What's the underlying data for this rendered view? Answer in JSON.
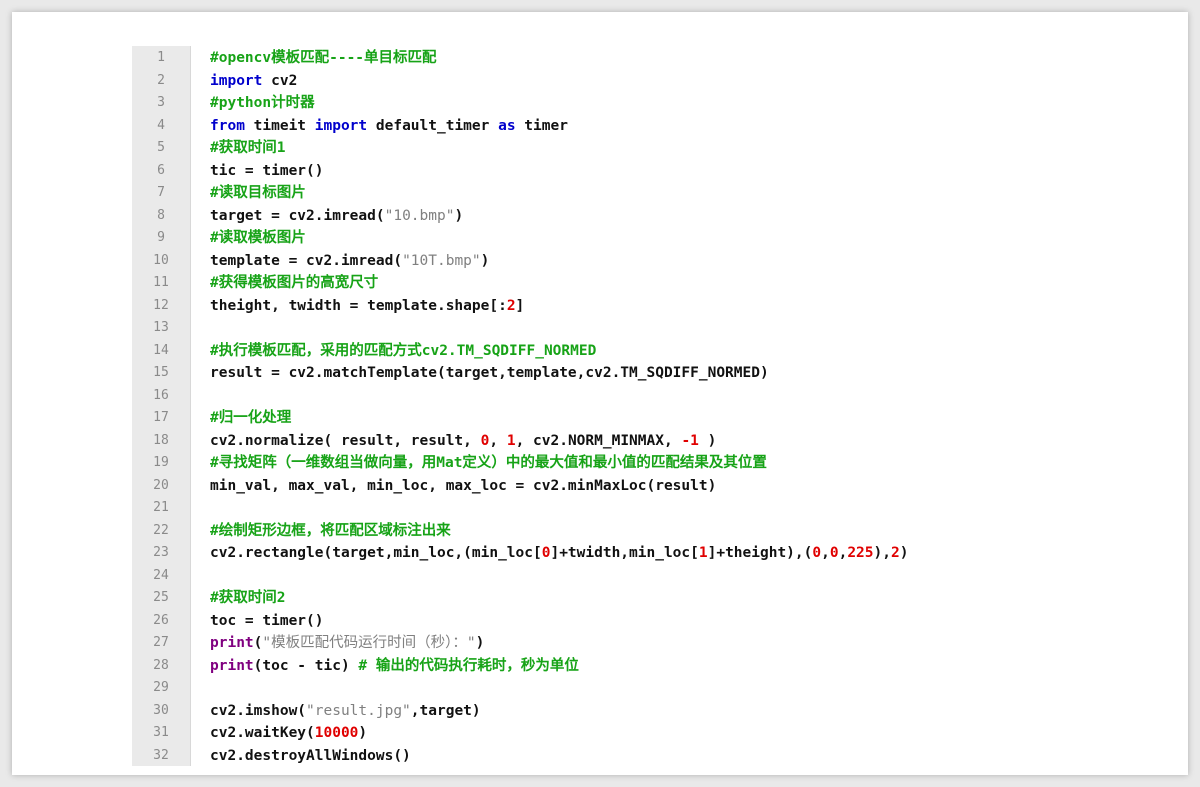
{
  "editor": {
    "lines": [
      {
        "num": "1",
        "tokens": [
          {
            "t": "#opencv模板匹配----单目标匹配",
            "c": "cm"
          }
        ]
      },
      {
        "num": "2",
        "tokens": [
          {
            "t": "import",
            "c": "kw"
          },
          {
            "t": " cv2",
            "c": "plain"
          }
        ]
      },
      {
        "num": "3",
        "tokens": [
          {
            "t": "#python计时器",
            "c": "cm"
          }
        ]
      },
      {
        "num": "4",
        "tokens": [
          {
            "t": "from",
            "c": "kw"
          },
          {
            "t": " timeit ",
            "c": "plain"
          },
          {
            "t": "import",
            "c": "kw"
          },
          {
            "t": " default_timer ",
            "c": "plain"
          },
          {
            "t": "as",
            "c": "kw"
          },
          {
            "t": " timer",
            "c": "plain"
          }
        ]
      },
      {
        "num": "5",
        "tokens": [
          {
            "t": "#获取时间1",
            "c": "cm"
          }
        ]
      },
      {
        "num": "6",
        "tokens": [
          {
            "t": "tic = timer()",
            "c": "plain"
          }
        ]
      },
      {
        "num": "7",
        "tokens": [
          {
            "t": "#读取目标图片",
            "c": "cm"
          }
        ]
      },
      {
        "num": "8",
        "tokens": [
          {
            "t": "target = cv2.imread(",
            "c": "plain"
          },
          {
            "t": "\"10.bmp\"",
            "c": "str"
          },
          {
            "t": ")",
            "c": "plain"
          }
        ]
      },
      {
        "num": "9",
        "tokens": [
          {
            "t": "#读取模板图片",
            "c": "cm"
          }
        ]
      },
      {
        "num": "10",
        "tokens": [
          {
            "t": "template = cv2.imread(",
            "c": "plain"
          },
          {
            "t": "\"10T.bmp\"",
            "c": "str"
          },
          {
            "t": ")",
            "c": "plain"
          }
        ]
      },
      {
        "num": "11",
        "tokens": [
          {
            "t": "#获得模板图片的高宽尺寸",
            "c": "cm"
          }
        ]
      },
      {
        "num": "12",
        "tokens": [
          {
            "t": "theight, twidth = template.shape[:",
            "c": "plain"
          },
          {
            "t": "2",
            "c": "num"
          },
          {
            "t": "]",
            "c": "plain"
          }
        ]
      },
      {
        "num": "13",
        "tokens": []
      },
      {
        "num": "14",
        "tokens": [
          {
            "t": "#执行模板匹配，采用的匹配方式cv2.TM_SQDIFF_NORMED",
            "c": "cm"
          }
        ]
      },
      {
        "num": "15",
        "tokens": [
          {
            "t": "result = cv2.matchTemplate(target,template,cv2.TM_SQDIFF_NORMED)",
            "c": "plain"
          }
        ]
      },
      {
        "num": "16",
        "tokens": []
      },
      {
        "num": "17",
        "tokens": [
          {
            "t": "#归一化处理",
            "c": "cm"
          }
        ]
      },
      {
        "num": "18",
        "tokens": [
          {
            "t": "cv2.normalize( result, result, ",
            "c": "plain"
          },
          {
            "t": "0",
            "c": "num"
          },
          {
            "t": ", ",
            "c": "plain"
          },
          {
            "t": "1",
            "c": "num"
          },
          {
            "t": ", cv2.NORM_MINMAX, ",
            "c": "plain"
          },
          {
            "t": "-1",
            "c": "num"
          },
          {
            "t": " )",
            "c": "plain"
          }
        ]
      },
      {
        "num": "19",
        "tokens": [
          {
            "t": "#寻找矩阵（一维数组当做向量，用Mat定义）中的最大值和最小值的匹配结果及其位置",
            "c": "cm"
          }
        ]
      },
      {
        "num": "20",
        "tokens": [
          {
            "t": "min_val, max_val, min_loc, max_loc = cv2.minMaxLoc(result)",
            "c": "plain"
          }
        ]
      },
      {
        "num": "21",
        "tokens": []
      },
      {
        "num": "22",
        "tokens": [
          {
            "t": "#绘制矩形边框，将匹配区域标注出来",
            "c": "cm"
          }
        ]
      },
      {
        "num": "23",
        "tokens": [
          {
            "t": "cv2.rectangle(target,min_loc,(min_loc[",
            "c": "plain"
          },
          {
            "t": "0",
            "c": "num"
          },
          {
            "t": "]+twidth,min_loc[",
            "c": "plain"
          },
          {
            "t": "1",
            "c": "num"
          },
          {
            "t": "]+theight),(",
            "c": "plain"
          },
          {
            "t": "0",
            "c": "num"
          },
          {
            "t": ",",
            "c": "plain"
          },
          {
            "t": "0",
            "c": "num"
          },
          {
            "t": ",",
            "c": "plain"
          },
          {
            "t": "225",
            "c": "num"
          },
          {
            "t": "),",
            "c": "plain"
          },
          {
            "t": "2",
            "c": "num"
          },
          {
            "t": ")",
            "c": "plain"
          }
        ]
      },
      {
        "num": "24",
        "tokens": []
      },
      {
        "num": "25",
        "tokens": [
          {
            "t": "#获取时间2",
            "c": "cm"
          }
        ]
      },
      {
        "num": "26",
        "tokens": [
          {
            "t": "toc = timer()",
            "c": "plain"
          }
        ]
      },
      {
        "num": "27",
        "tokens": [
          {
            "t": "print",
            "c": "bi"
          },
          {
            "t": "(",
            "c": "plain"
          },
          {
            "t": "\"模板匹配代码运行时间（秒）：\"",
            "c": "str"
          },
          {
            "t": ")",
            "c": "plain"
          }
        ]
      },
      {
        "num": "28",
        "tokens": [
          {
            "t": "print",
            "c": "bi"
          },
          {
            "t": "(toc - tic) ",
            "c": "plain"
          },
          {
            "t": "# 输出的代码执行耗时，秒为单位",
            "c": "cm"
          }
        ]
      },
      {
        "num": "29",
        "tokens": []
      },
      {
        "num": "30",
        "tokens": [
          {
            "t": "cv2.imshow(",
            "c": "plain"
          },
          {
            "t": "\"result.jpg\"",
            "c": "str"
          },
          {
            "t": ",target)",
            "c": "plain"
          }
        ]
      },
      {
        "num": "31",
        "tokens": [
          {
            "t": "cv2.waitKey(",
            "c": "plain"
          },
          {
            "t": "10000",
            "c": "num"
          },
          {
            "t": ")",
            "c": "plain"
          }
        ]
      },
      {
        "num": "32",
        "tokens": [
          {
            "t": "cv2.destroyAllWindows()",
            "c": "plain"
          }
        ]
      }
    ]
  }
}
